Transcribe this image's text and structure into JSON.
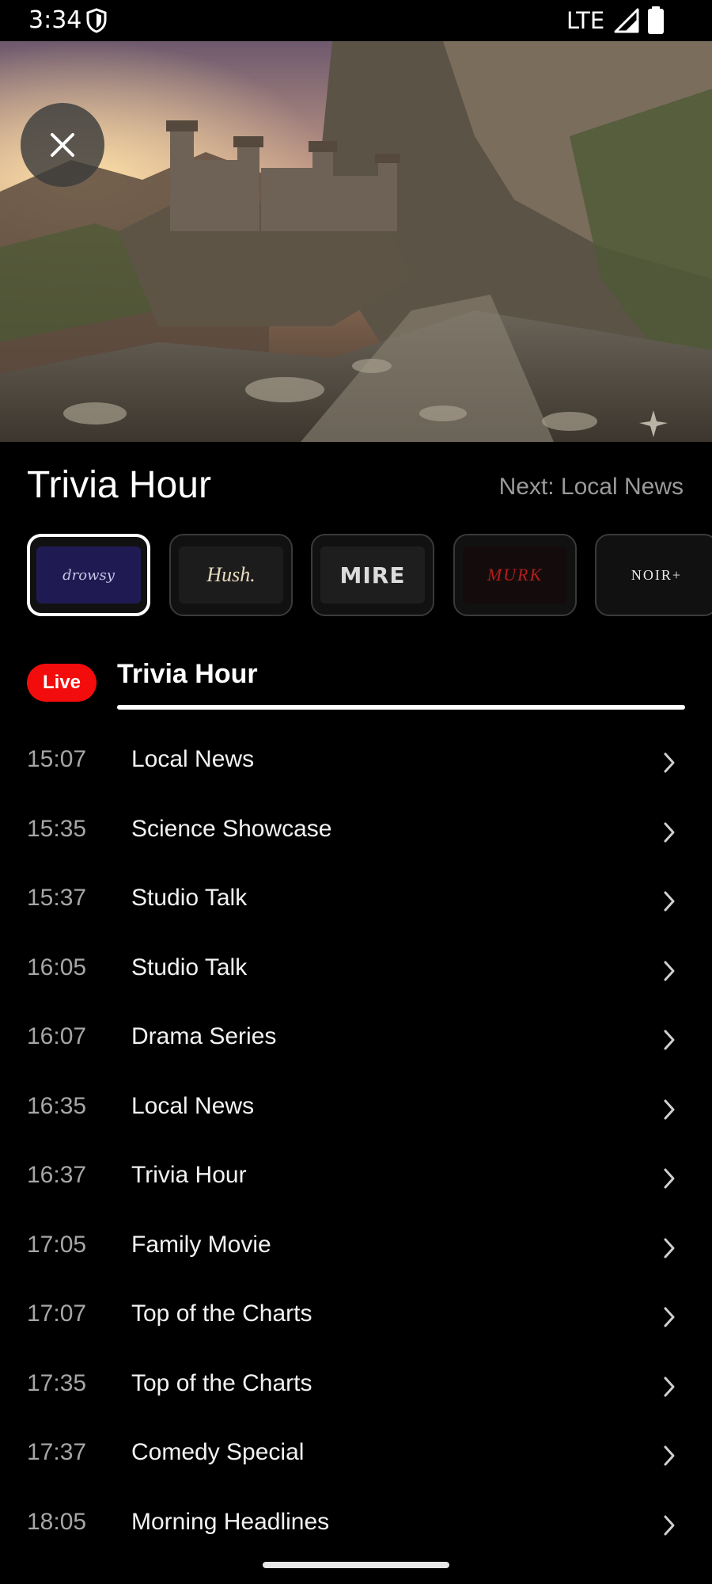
{
  "status_bar": {
    "time": "3:34",
    "network": "LTE"
  },
  "header": {
    "title": "Trivia Hour",
    "next_label": "Next: Local News"
  },
  "channels": [
    {
      "name": "drowsy",
      "selected": true
    },
    {
      "name": "Hush.",
      "selected": false
    },
    {
      "name": "MIRE",
      "selected": false
    },
    {
      "name": "MURK",
      "selected": false
    },
    {
      "name": "NOIR+",
      "selected": false
    }
  ],
  "live": {
    "badge": "Live",
    "title": "Trivia Hour",
    "progress": 1.0
  },
  "schedule": [
    {
      "time": "15:07",
      "title": "Local News"
    },
    {
      "time": "15:35",
      "title": "Science Showcase"
    },
    {
      "time": "15:37",
      "title": "Studio Talk"
    },
    {
      "time": "16:05",
      "title": "Studio Talk"
    },
    {
      "time": "16:07",
      "title": "Drama Series"
    },
    {
      "time": "16:35",
      "title": "Local News"
    },
    {
      "time": "16:37",
      "title": "Trivia Hour"
    },
    {
      "time": "17:05",
      "title": "Family Movie"
    },
    {
      "time": "17:07",
      "title": "Top of the Charts"
    },
    {
      "time": "17:35",
      "title": "Top of the Charts"
    },
    {
      "time": "17:37",
      "title": "Comedy Special"
    },
    {
      "time": "18:05",
      "title": "Morning Headlines"
    }
  ],
  "colors": {
    "live_red": "#f20c0c",
    "background": "#000000",
    "muted_text": "#9a9a9a"
  }
}
